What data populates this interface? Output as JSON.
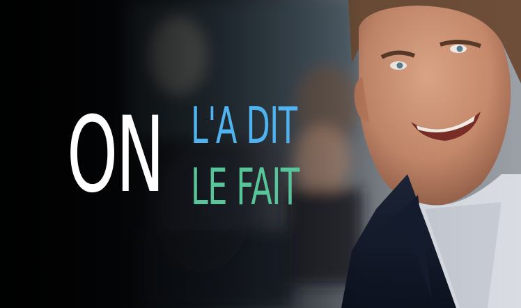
{
  "headline": {
    "word": "ON",
    "line1": "L'A DIT",
    "line2": "LE FAIT"
  },
  "colors": {
    "word": "#ffffff",
    "line1": "#4fb3ef",
    "line2": "#58c49a"
  }
}
